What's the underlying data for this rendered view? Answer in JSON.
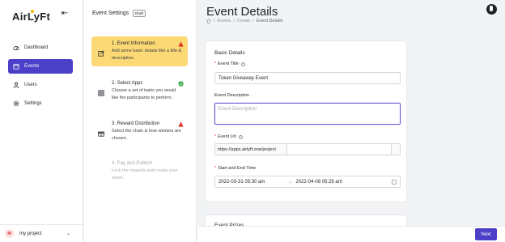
{
  "brand": {
    "name": "AirLyFt",
    "accent": "#4c3fc8",
    "highlight": "#fcd974"
  },
  "sidebar": {
    "collapse_icon": "arrow-left-icon",
    "items": [
      {
        "label": "Dashboard",
        "icon": "dashboard-icon",
        "active": false
      },
      {
        "label": "Events",
        "icon": "calendar-icon",
        "active": true
      },
      {
        "label": "Users",
        "icon": "user-icon",
        "active": false
      },
      {
        "label": "Settings",
        "icon": "gear-icon",
        "active": false
      }
    ],
    "project": {
      "avatar_letter": "M",
      "name": "my project"
    }
  },
  "steps": {
    "title": "Event Settings",
    "badge": "Draft",
    "items": [
      {
        "title": "1. Event Information",
        "desc": "Add some basic details like a title & description.",
        "status": "warning"
      },
      {
        "title": "2. Select Apps",
        "desc": "Choose a set of tasks you would like the participants to perform.",
        "status": "complete"
      },
      {
        "title": "3. Reward Distribution",
        "desc": "Select the chain & how winners are chosen.",
        "status": "warning"
      },
      {
        "title": "4. Pay and Publish",
        "desc": "Lock the rewards and create your event.",
        "status": "disabled"
      }
    ]
  },
  "main": {
    "title": "Event Details",
    "breadcrumb": [
      "Events",
      "Create",
      "Event Details"
    ],
    "basic_details": {
      "title": "Basic Details",
      "event_title_label": "Event Title",
      "event_title_value": "Token Giveaway Event",
      "event_desc_label": "Event Description",
      "event_desc_placeholder": "Event Description",
      "event_url_label": "Event Url",
      "event_url_prefix": "https://apps.airlyft.one/project",
      "date_label": "Start and End Time",
      "start_time": "2022-03-31 05:30 am",
      "end_time": "2022-04-08 05:29 am"
    },
    "next_section_title": "Event Prizes"
  },
  "footer": {
    "next_label": "Next"
  }
}
